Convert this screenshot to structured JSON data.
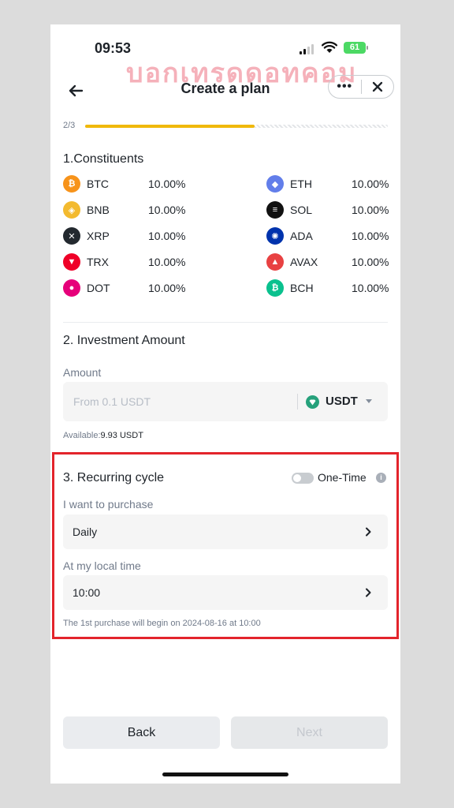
{
  "status_bar": {
    "time": "09:53",
    "battery": "61"
  },
  "watermark": "บอกเทรดดอทคอม",
  "header": {
    "title": "Create a plan",
    "more_label": "•••"
  },
  "progress": {
    "step_label": "2/3",
    "fraction": 0.56
  },
  "constituents": {
    "title": "1.Constituents",
    "items": [
      {
        "symbol": "BTC",
        "pct": "10.00%",
        "color": "#f7931a",
        "glyph": "₿"
      },
      {
        "symbol": "ETH",
        "pct": "10.00%",
        "color": "#627eea",
        "glyph": "◆"
      },
      {
        "symbol": "BNB",
        "pct": "10.00%",
        "color": "#f3ba2f",
        "glyph": "◈"
      },
      {
        "symbol": "SOL",
        "pct": "10.00%",
        "color": "#111111",
        "glyph": "≡"
      },
      {
        "symbol": "XRP",
        "pct": "10.00%",
        "color": "#23292f",
        "glyph": "✕"
      },
      {
        "symbol": "ADA",
        "pct": "10.00%",
        "color": "#0033ad",
        "glyph": "✺"
      },
      {
        "symbol": "TRX",
        "pct": "10.00%",
        "color": "#ef0027",
        "glyph": "▼"
      },
      {
        "symbol": "AVAX",
        "pct": "10.00%",
        "color": "#e84142",
        "glyph": "▲"
      },
      {
        "symbol": "DOT",
        "pct": "10.00%",
        "color": "#e6007a",
        "glyph": "●"
      },
      {
        "symbol": "BCH",
        "pct": "10.00%",
        "color": "#0ac18e",
        "glyph": "₿"
      }
    ]
  },
  "investment": {
    "title": "2. Investment Amount",
    "amount_label": "Amount",
    "placeholder": "From 0.1 USDT",
    "currency": "USDT",
    "available_label": "Available:",
    "available_value": "9.93 USDT"
  },
  "recurring": {
    "title": "3. Recurring cycle",
    "one_time_label": "One-Time",
    "purchase_label": "I want to purchase",
    "purchase_value": "Daily",
    "time_label": "At my local time",
    "time_value": "10:00",
    "note": "The 1st purchase will begin on 2024-08-16 at 10:00"
  },
  "buttons": {
    "back": "Back",
    "next": "Next"
  }
}
